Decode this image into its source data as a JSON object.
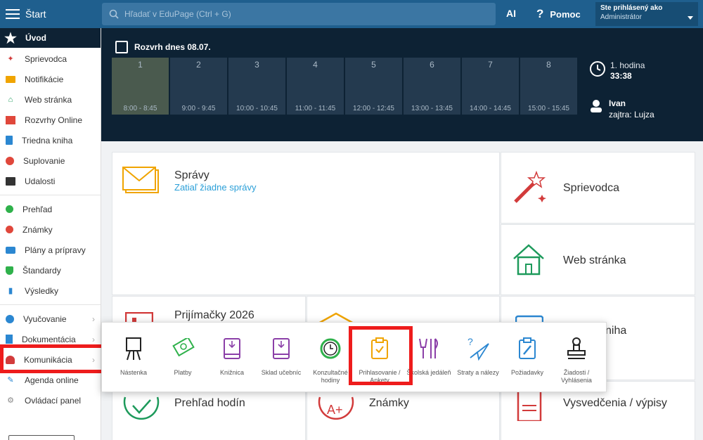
{
  "topbar": {
    "start_label": "Štart",
    "search_placeholder": "Hľadať v EduPage (Ctrl + G)",
    "ai_label": "AI",
    "help_label": "Pomoc",
    "user_line1": "Ste prihlásený ako",
    "user_line2": "Administrátor"
  },
  "sidebar": {
    "active": "Úvod",
    "group1": [
      "Sprievodca",
      "Notifikácie",
      "Web stránka",
      "Rozvrhy Online",
      "Triedna kniha",
      "Suplovanie",
      "Udalosti"
    ],
    "group2": [
      "Prehľad",
      "Známky",
      "Plány a prípravy",
      "Štandardy",
      "Výsledky"
    ],
    "group3": [
      "Vyučovanie",
      "Dokumentácia",
      "Komunikácia",
      "Agenda online",
      "Ovládací panel"
    ]
  },
  "timetable": {
    "title": "Rozvrh dnes 08.07.",
    "periods": [
      {
        "num": "1",
        "time": "8:00 - 8:45"
      },
      {
        "num": "2",
        "time": "9:00 - 9:45"
      },
      {
        "num": "3",
        "time": "10:00 - 10:45"
      },
      {
        "num": "4",
        "time": "11:00 - 11:45"
      },
      {
        "num": "5",
        "time": "12:00 - 12:45"
      },
      {
        "num": "6",
        "time": "13:00 - 13:45"
      },
      {
        "num": "7",
        "time": "14:00 - 14:45"
      },
      {
        "num": "8",
        "time": "15:00 - 15:45"
      }
    ],
    "current_period": "1. hodina",
    "countdown": "33:38",
    "teacher_name": "Ivan",
    "teacher_tomorrow": "zajtra: Lujza"
  },
  "tiles": {
    "spravy": "Správy",
    "spravy_sub": "Zatiaľ žiadne správy",
    "sprievodca": "Sprievodca",
    "web": "Web stránka",
    "prijimacky": "Prijímačky 2026",
    "kniha": "kniha",
    "prehlad": "Prehľad hodín",
    "znamky": "Známky",
    "vysvedcenia": "Vysvedčenia / výpisy"
  },
  "popup": {
    "items": [
      "Nástenka",
      "Platby",
      "Knižnica",
      "Sklad učebníc",
      "Konzultačné hodiny",
      "Prihlasovanie / Ankety",
      "Školská jedáleň",
      "Straty a nálezy",
      "Požiadavky",
      "Žiadosti / Vyhlásenia"
    ]
  },
  "colors": {
    "topbar": "#1f5f8e",
    "banner": "#0d2234",
    "highlight": "#ee1c1c",
    "accent_blue": "#2b9fd8"
  }
}
